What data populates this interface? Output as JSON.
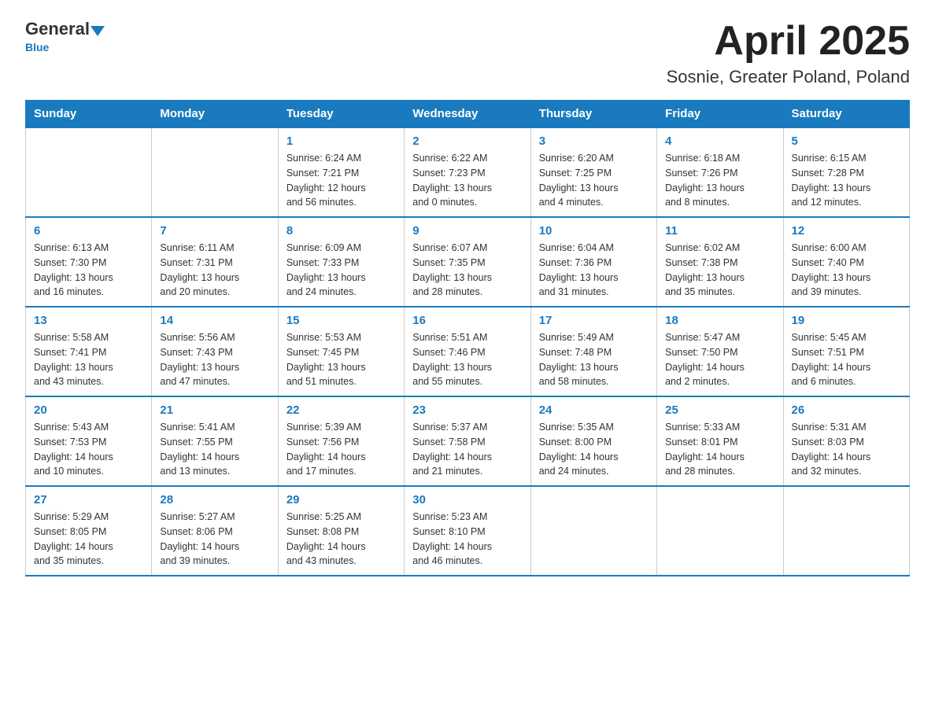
{
  "header": {
    "logo": {
      "general": "General",
      "blue": "Blue",
      "underline": "Blue"
    },
    "title": "April 2025",
    "location": "Sosnie, Greater Poland, Poland"
  },
  "days_of_week": [
    "Sunday",
    "Monday",
    "Tuesday",
    "Wednesday",
    "Thursday",
    "Friday",
    "Saturday"
  ],
  "weeks": [
    [
      {
        "day": "",
        "info": ""
      },
      {
        "day": "",
        "info": ""
      },
      {
        "day": "1",
        "info": "Sunrise: 6:24 AM\nSunset: 7:21 PM\nDaylight: 12 hours\nand 56 minutes."
      },
      {
        "day": "2",
        "info": "Sunrise: 6:22 AM\nSunset: 7:23 PM\nDaylight: 13 hours\nand 0 minutes."
      },
      {
        "day": "3",
        "info": "Sunrise: 6:20 AM\nSunset: 7:25 PM\nDaylight: 13 hours\nand 4 minutes."
      },
      {
        "day": "4",
        "info": "Sunrise: 6:18 AM\nSunset: 7:26 PM\nDaylight: 13 hours\nand 8 minutes."
      },
      {
        "day": "5",
        "info": "Sunrise: 6:15 AM\nSunset: 7:28 PM\nDaylight: 13 hours\nand 12 minutes."
      }
    ],
    [
      {
        "day": "6",
        "info": "Sunrise: 6:13 AM\nSunset: 7:30 PM\nDaylight: 13 hours\nand 16 minutes."
      },
      {
        "day": "7",
        "info": "Sunrise: 6:11 AM\nSunset: 7:31 PM\nDaylight: 13 hours\nand 20 minutes."
      },
      {
        "day": "8",
        "info": "Sunrise: 6:09 AM\nSunset: 7:33 PM\nDaylight: 13 hours\nand 24 minutes."
      },
      {
        "day": "9",
        "info": "Sunrise: 6:07 AM\nSunset: 7:35 PM\nDaylight: 13 hours\nand 28 minutes."
      },
      {
        "day": "10",
        "info": "Sunrise: 6:04 AM\nSunset: 7:36 PM\nDaylight: 13 hours\nand 31 minutes."
      },
      {
        "day": "11",
        "info": "Sunrise: 6:02 AM\nSunset: 7:38 PM\nDaylight: 13 hours\nand 35 minutes."
      },
      {
        "day": "12",
        "info": "Sunrise: 6:00 AM\nSunset: 7:40 PM\nDaylight: 13 hours\nand 39 minutes."
      }
    ],
    [
      {
        "day": "13",
        "info": "Sunrise: 5:58 AM\nSunset: 7:41 PM\nDaylight: 13 hours\nand 43 minutes."
      },
      {
        "day": "14",
        "info": "Sunrise: 5:56 AM\nSunset: 7:43 PM\nDaylight: 13 hours\nand 47 minutes."
      },
      {
        "day": "15",
        "info": "Sunrise: 5:53 AM\nSunset: 7:45 PM\nDaylight: 13 hours\nand 51 minutes."
      },
      {
        "day": "16",
        "info": "Sunrise: 5:51 AM\nSunset: 7:46 PM\nDaylight: 13 hours\nand 55 minutes."
      },
      {
        "day": "17",
        "info": "Sunrise: 5:49 AM\nSunset: 7:48 PM\nDaylight: 13 hours\nand 58 minutes."
      },
      {
        "day": "18",
        "info": "Sunrise: 5:47 AM\nSunset: 7:50 PM\nDaylight: 14 hours\nand 2 minutes."
      },
      {
        "day": "19",
        "info": "Sunrise: 5:45 AM\nSunset: 7:51 PM\nDaylight: 14 hours\nand 6 minutes."
      }
    ],
    [
      {
        "day": "20",
        "info": "Sunrise: 5:43 AM\nSunset: 7:53 PM\nDaylight: 14 hours\nand 10 minutes."
      },
      {
        "day": "21",
        "info": "Sunrise: 5:41 AM\nSunset: 7:55 PM\nDaylight: 14 hours\nand 13 minutes."
      },
      {
        "day": "22",
        "info": "Sunrise: 5:39 AM\nSunset: 7:56 PM\nDaylight: 14 hours\nand 17 minutes."
      },
      {
        "day": "23",
        "info": "Sunrise: 5:37 AM\nSunset: 7:58 PM\nDaylight: 14 hours\nand 21 minutes."
      },
      {
        "day": "24",
        "info": "Sunrise: 5:35 AM\nSunset: 8:00 PM\nDaylight: 14 hours\nand 24 minutes."
      },
      {
        "day": "25",
        "info": "Sunrise: 5:33 AM\nSunset: 8:01 PM\nDaylight: 14 hours\nand 28 minutes."
      },
      {
        "day": "26",
        "info": "Sunrise: 5:31 AM\nSunset: 8:03 PM\nDaylight: 14 hours\nand 32 minutes."
      }
    ],
    [
      {
        "day": "27",
        "info": "Sunrise: 5:29 AM\nSunset: 8:05 PM\nDaylight: 14 hours\nand 35 minutes."
      },
      {
        "day": "28",
        "info": "Sunrise: 5:27 AM\nSunset: 8:06 PM\nDaylight: 14 hours\nand 39 minutes."
      },
      {
        "day": "29",
        "info": "Sunrise: 5:25 AM\nSunset: 8:08 PM\nDaylight: 14 hours\nand 43 minutes."
      },
      {
        "day": "30",
        "info": "Sunrise: 5:23 AM\nSunset: 8:10 PM\nDaylight: 14 hours\nand 46 minutes."
      },
      {
        "day": "",
        "info": ""
      },
      {
        "day": "",
        "info": ""
      },
      {
        "day": "",
        "info": ""
      }
    ]
  ]
}
